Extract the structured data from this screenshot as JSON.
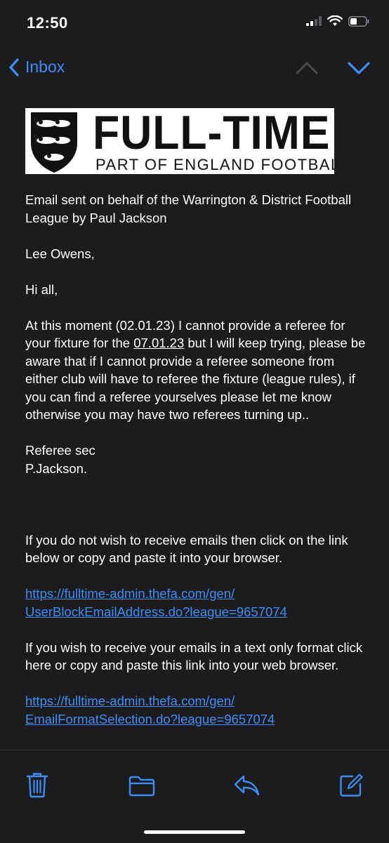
{
  "status_bar": {
    "time": "12:50"
  },
  "nav": {
    "back_label": "Inbox"
  },
  "banner": {
    "title": "FULL-TIME",
    "subtitle": "PART OF ENGLAND FOOTBALL"
  },
  "email": {
    "intro": "Email sent on behalf of the Warrington & District Football League by Paul Jackson",
    "recipient": "Lee Owens,",
    "greeting": "Hi all,",
    "paragraph_start": "At this moment (02.01.23) I cannot provide a referee for your fixture for the ",
    "date_link": "07.01.23",
    "paragraph_end": " but I will keep trying, please be aware that if I cannot provide a referee someone from either club will have to referee the fixture (league rules), if you can find a referee yourselves please let me know otherwise you may have two referees turning up..",
    "signoff_line1": "Referee sec",
    "signoff_line2": "P.Jackson.",
    "unsubscribe_text": "If you do not wish to receive emails then click on the link below or copy and paste it into your browser.",
    "unsubscribe_link_line1": "https://fulltime-admin.thefa.com/gen/",
    "unsubscribe_link_line2": "UserBlockEmailAddress.do?league=9657074",
    "textonly_text": "If you wish to receive your emails in a text only format click here or copy and paste this link into your web browser.",
    "textonly_link_line1": "https://fulltime-admin.thefa.com/gen/",
    "textonly_link_line2": "EmailFormatSelection.do?league=9657074"
  },
  "colors": {
    "accent": "#3e8ef7",
    "background": "#1c1c1e",
    "text": "#ffffff"
  },
  "toolbar": {
    "icons": [
      "trash-icon",
      "folder-icon",
      "reply-icon",
      "compose-icon"
    ]
  }
}
